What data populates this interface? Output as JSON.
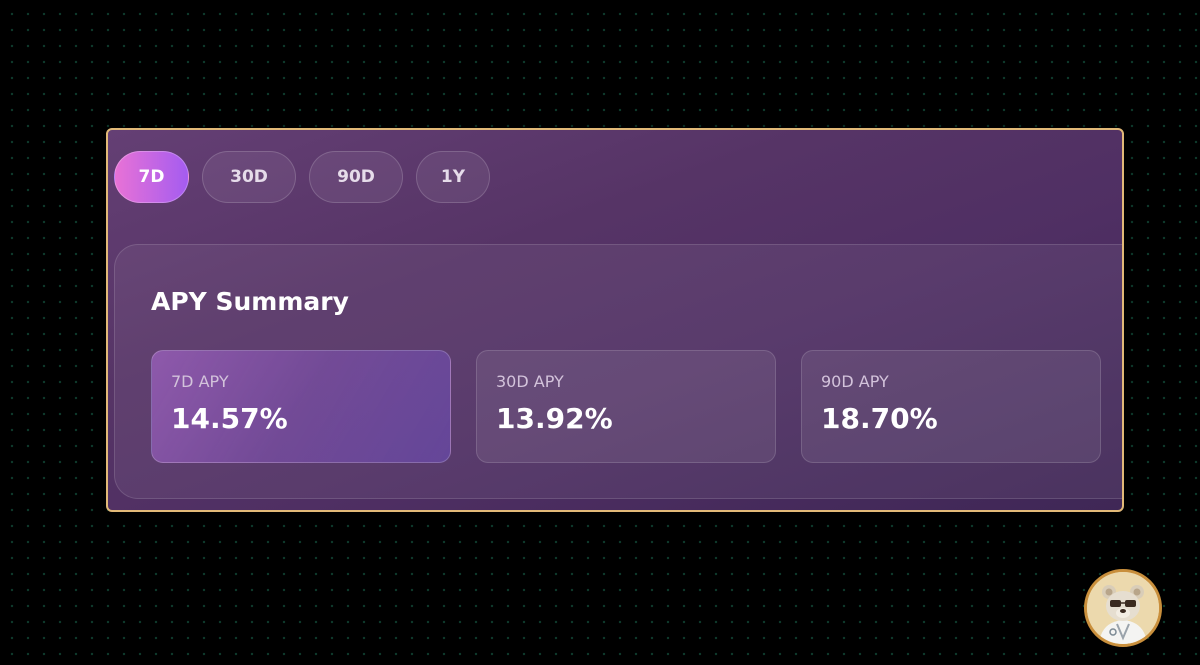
{
  "tabs": [
    {
      "label": "7D",
      "active": true
    },
    {
      "label": "30D",
      "active": false
    },
    {
      "label": "90D",
      "active": false
    },
    {
      "label": "1Y",
      "active": false
    }
  ],
  "summary": {
    "title": "APY Summary",
    "cards": [
      {
        "label": "7D APY",
        "value": "14.57%"
      },
      {
        "label": "30D APY",
        "value": "13.92%"
      },
      {
        "label": "90D APY",
        "value": "18.70%"
      }
    ]
  },
  "colors": {
    "page_background": "#000000",
    "panel_border": "#e2b978",
    "active_tab_start": "#e872d6",
    "active_tab_end": "#a45cf0",
    "panel_background": "#563466"
  },
  "avatar": {
    "icon": "bear-avatar-icon"
  }
}
